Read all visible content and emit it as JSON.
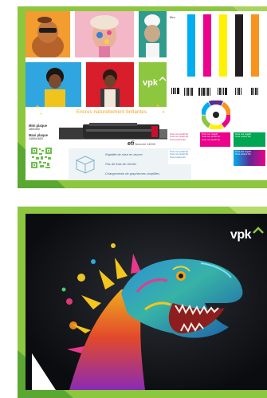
{
  "top_sample": {
    "headline": "Encres naturellement brillantes",
    "logo": "vpk",
    "spec_title_1": "Mini plaque",
    "spec_sub_1": "280x400",
    "spec_title_2": "Maxi plaque",
    "spec_sub_2": "1450x1600",
    "printer_brand": "efi",
    "printer_model": "Nozomi 14000",
    "features": [
      "Rapidité de mise en œuvre",
      "Pas de frais de clichés",
      "Changements de graphismes simplifiés"
    ],
    "calibration_label": "Bleu",
    "text_blocks": [
      "Texte noir positif 2pt",
      "Texte noir positif 4pt",
      "Texte noir négatif",
      "Texte couleur 6pt"
    ],
    "colors": {
      "frame_green": "#8dc63f",
      "cyan": "#00aeef",
      "magenta": "#ec008c",
      "yellow": "#fff200",
      "black": "#231f20",
      "accent_orange": "#f0a51c"
    }
  },
  "bottom_sample": {
    "logo": "vpk",
    "subject": "dinosaur-illustration"
  },
  "icons": [
    "qr-code-icon",
    "printer-image",
    "color-wheel-icon",
    "barcode-icon",
    "cube-icon",
    "sparkle-icon"
  ]
}
